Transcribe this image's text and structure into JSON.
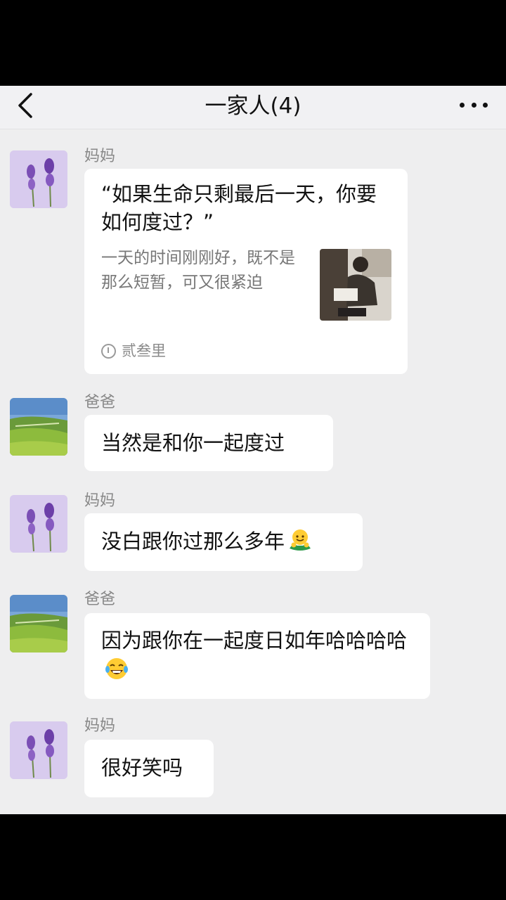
{
  "header": {
    "title": "一家人(4)"
  },
  "messages": [
    {
      "sender": "妈妈",
      "avatar": "lavender-flower-avatar",
      "link_title": "“如果生命只剩最后一天，你要如何度过？”",
      "link_description": "一天的时间刚刚好，既不是那么短暂，可又很紧迫",
      "link_source": "贰叁里"
    },
    {
      "sender": "爸爸",
      "avatar": "green-field-avatar",
      "text": "当然是和你一起度过"
    },
    {
      "sender": "妈妈",
      "avatar": "lavender-flower-avatar",
      "text": "没白跟你过那么多年",
      "emoji": "hug-emoji"
    },
    {
      "sender": "爸爸",
      "avatar": "green-field-avatar",
      "text": "因为跟你在一起度日如年哈哈哈哈",
      "emoji": "tears-of-joy-emoji"
    },
    {
      "sender": "妈妈",
      "avatar": "lavender-flower-avatar",
      "text": "很好笑吗"
    }
  ],
  "colors": {
    "background": "#eeeeef",
    "bubble": "#ffffff",
    "sender_text": "#888888"
  }
}
